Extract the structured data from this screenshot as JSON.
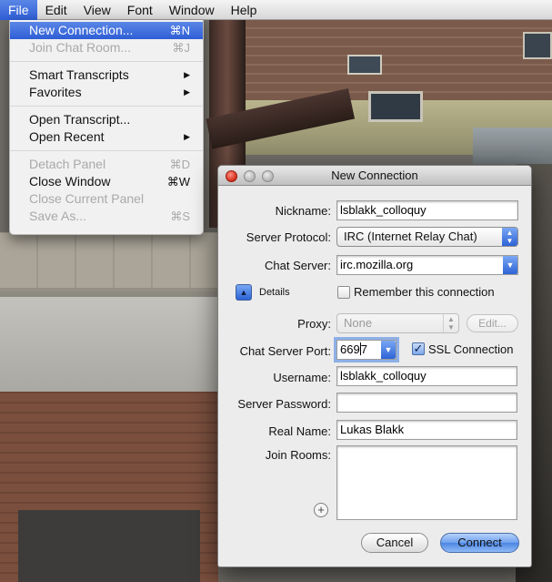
{
  "menubar": {
    "apple": "",
    "items": [
      "File",
      "Edit",
      "View",
      "Font",
      "Window",
      "Help"
    ]
  },
  "file_menu": {
    "items": [
      {
        "label": "New Connection...",
        "shortcut": "⌘N",
        "highlighted": true
      },
      {
        "label": "Join Chat Room...",
        "shortcut": "⌘J",
        "disabled": true
      },
      {
        "label": "Smart Transcripts",
        "submenu": true
      },
      {
        "label": "Favorites",
        "submenu": true
      },
      {
        "label": "Open Transcript..."
      },
      {
        "label": "Open Recent",
        "submenu": true
      },
      {
        "label": "Detach Panel",
        "shortcut": "⌘D",
        "disabled": true
      },
      {
        "label": "Close Window",
        "shortcut": "⌘W"
      },
      {
        "label": "Close Current Panel",
        "disabled": true
      },
      {
        "label": "Save As...",
        "shortcut": "⌘S",
        "disabled": true
      }
    ],
    "submenu_glyph": "▶"
  },
  "window": {
    "title": "New Connection",
    "nickname_label": "Nickname:",
    "nickname_value": "lsblakk_colloquy",
    "protocol_label": "Server Protocol:",
    "protocol_value": "IRC (Internet Relay Chat)",
    "server_label": "Chat Server:",
    "server_value": "irc.mozilla.org",
    "details_label": "Details",
    "remember_label": "Remember this connection",
    "remember_checked": false,
    "proxy_label": "Proxy:",
    "proxy_value": "None",
    "edit_label": "Edit...",
    "port_label": "Chat Server Port:",
    "port_value_before_caret": "669",
    "port_value_after_caret": "7",
    "ssl_label": "SSL Connection",
    "ssl_checked": true,
    "username_label": "Username:",
    "username_value": "lsblakk_colloquy",
    "password_label": "Server Password:",
    "password_value": "",
    "realname_label": "Real Name:",
    "realname_value": "Lukas Blakk",
    "rooms_label": "Join Rooms:",
    "add_room_glyph": "+",
    "cancel_label": "Cancel",
    "connect_label": "Connect"
  },
  "glyphs": {
    "check": "✓",
    "combo_arrow": "▼",
    "popup_arrows_up": "▲",
    "popup_arrows_down": "▼",
    "disclosure_up": "▲"
  },
  "colors": {
    "accent": "#2f5ed6",
    "close_button": "#d22c1a"
  }
}
